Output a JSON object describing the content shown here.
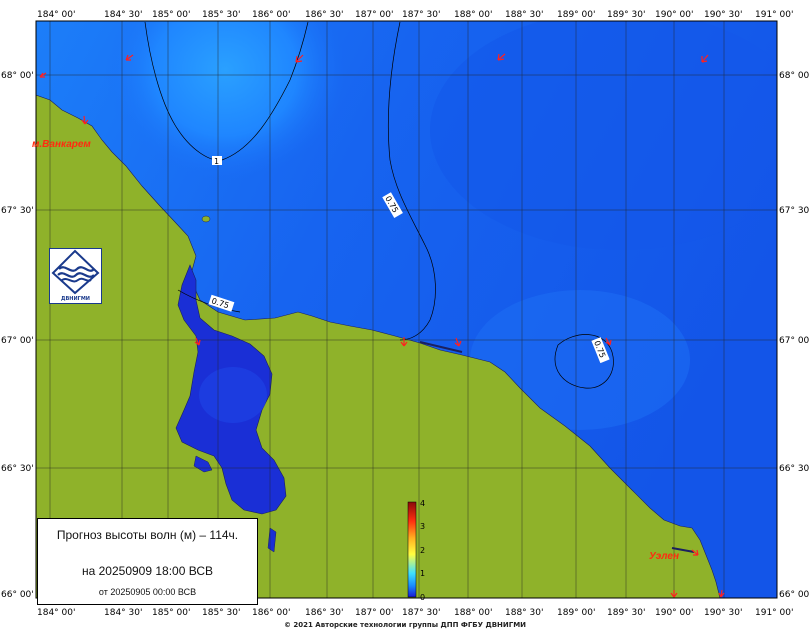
{
  "map": {
    "lon_labels": [
      "184° 00'",
      "184° 30'",
      "185° 00'",
      "185° 30'",
      "186° 00'",
      "186° 30'",
      "187° 00'",
      "187° 30'",
      "188° 00'",
      "188° 30'",
      "189° 00'",
      "189° 30'",
      "190° 00'",
      "190° 30'",
      "191° 00'"
    ],
    "lat_labels": [
      "68° 00'",
      "67° 30'",
      "67° 00'",
      "66° 30'",
      "66° 00'"
    ],
    "contour_labels": [
      "1",
      "0.75",
      "0.75",
      "0.75"
    ],
    "places": {
      "vankarem": "м.Ванкарем",
      "uelen": "Уэлен"
    },
    "colors": {
      "land": "#8fb22a",
      "sea_light": "#1f8fff",
      "sea_mid": "#1461ef",
      "sea_deep": "#1a2fd6",
      "arrow": "#ff2020"
    }
  },
  "scale": {
    "ticks": [
      "4",
      "3",
      "2",
      "1",
      "0"
    ]
  },
  "info": {
    "title": "Прогноз высоты волн (м) – 114ч.",
    "valid": "на 20250909 18:00 ВСВ",
    "issued": "от 20250905 00:00 ВСВ"
  },
  "logo": {
    "text": "ДВНИГМИ"
  },
  "copyright": "© 2021 Авторские технологии группы ДПП ФГБУ ДВНИГМИ"
}
